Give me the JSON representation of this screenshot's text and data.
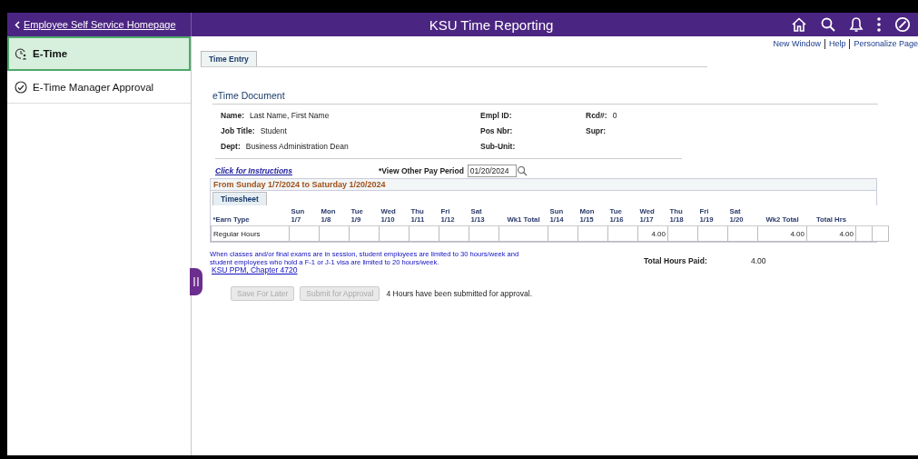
{
  "header": {
    "back_link": "Employee Self Service Homepage",
    "title": "KSU Time Reporting"
  },
  "page_links": [
    "New Window",
    "Help",
    "Personalize Page"
  ],
  "sidebar": {
    "items": [
      {
        "label": "E-Time",
        "selected": true
      },
      {
        "label": "E-Time Manager Approval",
        "selected": false
      }
    ]
  },
  "tabs": [
    {
      "label": "Time Entry",
      "selected": true
    }
  ],
  "document": {
    "title": "eTime Document",
    "fields": [
      {
        "label": "Name:",
        "value": "Last Name, First Name"
      },
      {
        "label": "Empl ID:"
      },
      {
        "label": "Rcd#:",
        "value": "0"
      },
      {
        "label": "Job Title:",
        "value": "Student"
      },
      {
        "label": "Pos Nbr:"
      },
      {
        "label": "Supr:"
      },
      {
        "label": "Dept:",
        "value": "Business Administration Dean"
      },
      {
        "label": "Sub-Unit:"
      }
    ],
    "instructions_link": "Click for Instructions",
    "pay_period": {
      "label": "*View Other Pay Period",
      "value": "01/20/2024"
    },
    "period_heading": "From Sunday 1/7/2024 to Saturday 1/20/2024",
    "timesheet_tab": "Timesheet",
    "table": {
      "columns": [
        {
          "kind": "label",
          "label": "*Earn Type"
        },
        {
          "kind": "day",
          "day": "Sun",
          "date": "1/7"
        },
        {
          "kind": "day",
          "day": "Mon",
          "date": "1/8"
        },
        {
          "kind": "day",
          "day": "Tue",
          "date": "1/9"
        },
        {
          "kind": "day",
          "day": "Wed",
          "date": "1/10"
        },
        {
          "kind": "day",
          "day": "Thu",
          "date": "1/11"
        },
        {
          "kind": "day",
          "day": "Fri",
          "date": "1/12"
        },
        {
          "kind": "day",
          "day": "Sat",
          "date": "1/13"
        },
        {
          "kind": "total",
          "label": "Wk1 Total"
        },
        {
          "kind": "day",
          "day": "Sun",
          "date": "1/14"
        },
        {
          "kind": "day",
          "day": "Mon",
          "date": "1/15"
        },
        {
          "kind": "day",
          "day": "Tue",
          "date": "1/16"
        },
        {
          "kind": "day",
          "day": "Wed",
          "date": "1/17"
        },
        {
          "kind": "day",
          "day": "Thu",
          "date": "1/18"
        },
        {
          "kind": "day",
          "day": "Fri",
          "date": "1/19"
        },
        {
          "kind": "day",
          "day": "Sat",
          "date": "1/20"
        },
        {
          "kind": "total",
          "label": "Wk2 Total"
        },
        {
          "kind": "total",
          "label": "Total Hrs"
        },
        {
          "kind": "blank"
        },
        {
          "kind": "blank"
        }
      ],
      "rows": [
        {
          "cells": [
            "Regular Hours",
            null,
            null,
            null,
            null,
            null,
            null,
            null,
            null,
            null,
            null,
            null,
            "4.00",
            null,
            null,
            null,
            "4.00",
            "4.00",
            null,
            null
          ]
        }
      ]
    },
    "note": "When classes and/or final exams are in session, student employees are limited to 30 hours/week and student employees who hold a F-1 or J-1 visa are limited to 20 hours/week.",
    "note_link": "KSU PPM, Chapter 4720",
    "total_paid": {
      "label": "Total Hours Paid:",
      "value": "4.00"
    },
    "buttons": [
      {
        "label": "Save For Later",
        "disabled": true
      },
      {
        "label": "Submit for Approval",
        "disabled": true
      }
    ],
    "status": "4 Hours have been submitted for approval."
  }
}
